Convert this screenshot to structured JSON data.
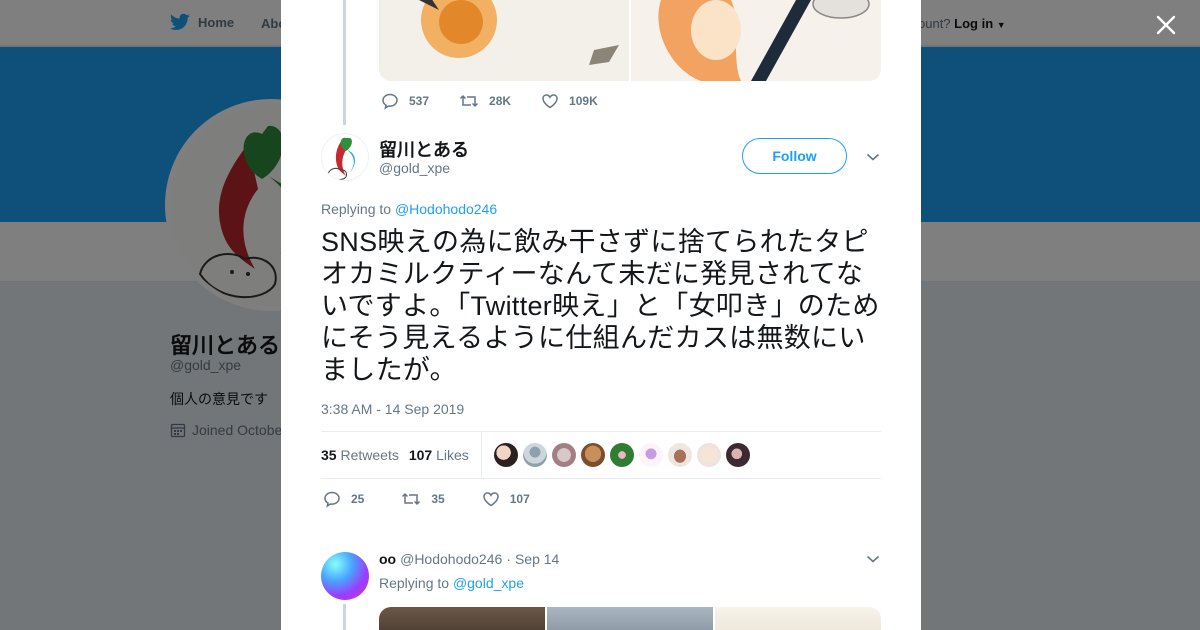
{
  "nav": {
    "home": "Home",
    "about": "Abo",
    "account_prompt": "ccount?",
    "login": "Log in"
  },
  "profile": {
    "name": "留川とある",
    "handle": "@gold_xpe",
    "bio": "個人の意見です",
    "joined": "Joined Octobe"
  },
  "previous_tweet": {
    "replies": "537",
    "retweets": "28K",
    "likes": "109K"
  },
  "tweet": {
    "author_name": "留川とある",
    "author_handle": "@gold_xpe",
    "follow_label": "Follow",
    "replying_prefix": "Replying to",
    "replying_handle": "@Hodohodo246",
    "text": "SNS映えの為に飲み干さずに捨てられたタピオカミルクティーなんて未だに発見されてないですよ。「Twitter映え」と「女叩き」のためにそう見えるように仕組んだカスは無数にいましたが。",
    "timestamp": "3:38 AM - 14 Sep 2019",
    "retweet_count": "35",
    "retweet_label": "Retweets",
    "like_count": "107",
    "like_label": "Likes",
    "replies": "25",
    "retweets": "35",
    "likes": "107"
  },
  "reply": {
    "name": "oo",
    "handle": "@Hodohodo246",
    "separator": "·",
    "date": "Sep 14",
    "replying_prefix": "Replying to",
    "replying_handle": "@gold_xpe"
  },
  "colors": {
    "accent": "#1da1f2",
    "banner": "#1da1f2"
  }
}
